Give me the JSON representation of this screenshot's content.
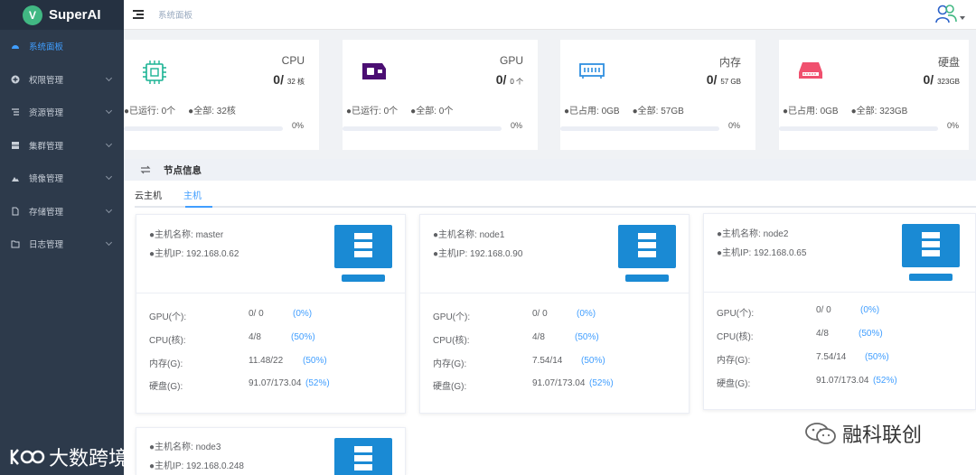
{
  "app": {
    "name": "SuperAI",
    "logo_letter": "V",
    "brand_color": "#41b883"
  },
  "sidebar": {
    "items": [
      {
        "label": "系统面板",
        "icon": "dashboard-icon",
        "active": true
      },
      {
        "label": "权限管理",
        "icon": "plus-circle-icon",
        "expandable": true
      },
      {
        "label": "资源管理",
        "icon": "list-icon",
        "expandable": true
      },
      {
        "label": "集群管理",
        "icon": "server-icon",
        "expandable": true
      },
      {
        "label": "镜像管理",
        "icon": "image-icon",
        "expandable": true
      },
      {
        "label": "存储管理",
        "icon": "storage-icon",
        "expandable": true
      },
      {
        "label": "日志管理",
        "icon": "folder-icon",
        "expandable": true
      }
    ]
  },
  "header": {
    "breadcrumb": "系统面板"
  },
  "stats": [
    {
      "name": "CPU",
      "used": "0/",
      "total": "32 核",
      "meta1": "●已运行: 0个",
      "meta2": "●全部: 32核",
      "percent": 0,
      "percent_label": "0%",
      "color": "#1ab394"
    },
    {
      "name": "GPU",
      "used": "0/",
      "total": "0 个",
      "meta1": "●已运行: 0个",
      "meta2": "●全部: 0个",
      "percent": 0,
      "percent_label": "0%",
      "color": "#4b0f73"
    },
    {
      "name": "内存",
      "used": "0/",
      "total": "57 GB",
      "meta1": "●已占用: 0GB",
      "meta2": "●全部: 57GB",
      "percent": 0,
      "percent_label": "0%",
      "color": "#2f8fe0"
    },
    {
      "name": "硬盘",
      "used": "0/",
      "total": "323GB",
      "meta1": "●已占用: 0GB",
      "meta2": "●全部: 323GB",
      "percent": 0,
      "percent_label": "0%",
      "color": "#f0506e"
    }
  ],
  "nodes_section": {
    "title": "节点信息",
    "tabs": [
      {
        "label": "云主机"
      },
      {
        "label": "主机",
        "active": true
      }
    ]
  },
  "nodes": [
    {
      "name": "●主机名称: master",
      "ip": "●主机IP: 192.168.0.62",
      "rows": [
        {
          "label": "GPU(个):",
          "value": "0/ 0",
          "pct": "(0%)"
        },
        {
          "label": "CPU(核):",
          "value": "4/8",
          "pct": "(50%)"
        },
        {
          "label": "内存(G):",
          "value": "11.48/22",
          "pct": "(50%)"
        },
        {
          "label": "硬盘(G):",
          "value": "91.07/173.04",
          "pct": "(52%)"
        }
      ]
    },
    {
      "name": "●主机名称: node1",
      "ip": "●主机IP: 192.168.0.90",
      "rows": [
        {
          "label": "GPU(个):",
          "value": "0/ 0",
          "pct": "(0%)"
        },
        {
          "label": "CPU(核):",
          "value": "4/8",
          "pct": "(50%)"
        },
        {
          "label": "内存(G):",
          "value": "7.54/14",
          "pct": "(50%)"
        },
        {
          "label": "硬盘(G):",
          "value": "91.07/173.04",
          "pct": "(52%)"
        }
      ]
    },
    {
      "name": "●主机名称: node2",
      "ip": "●主机IP: 192.168.0.65",
      "rows": [
        {
          "label": "GPU(个):",
          "value": "0/ 0",
          "pct": "(0%)"
        },
        {
          "label": "CPU(核):",
          "value": "4/8",
          "pct": "(50%)"
        },
        {
          "label": "内存(G):",
          "value": "7.54/14",
          "pct": "(50%)"
        },
        {
          "label": "硬盘(G):",
          "value": "91.07/173.04",
          "pct": "(52%)"
        }
      ]
    },
    {
      "name": "●主机名称: node3",
      "ip": "●主机IP: 192.168.0.248"
    }
  ],
  "accent_color": "#409eff",
  "server_icon_color": "#1a8ad4",
  "watermarks": {
    "left": "大数跨境",
    "right": "融科联创"
  }
}
